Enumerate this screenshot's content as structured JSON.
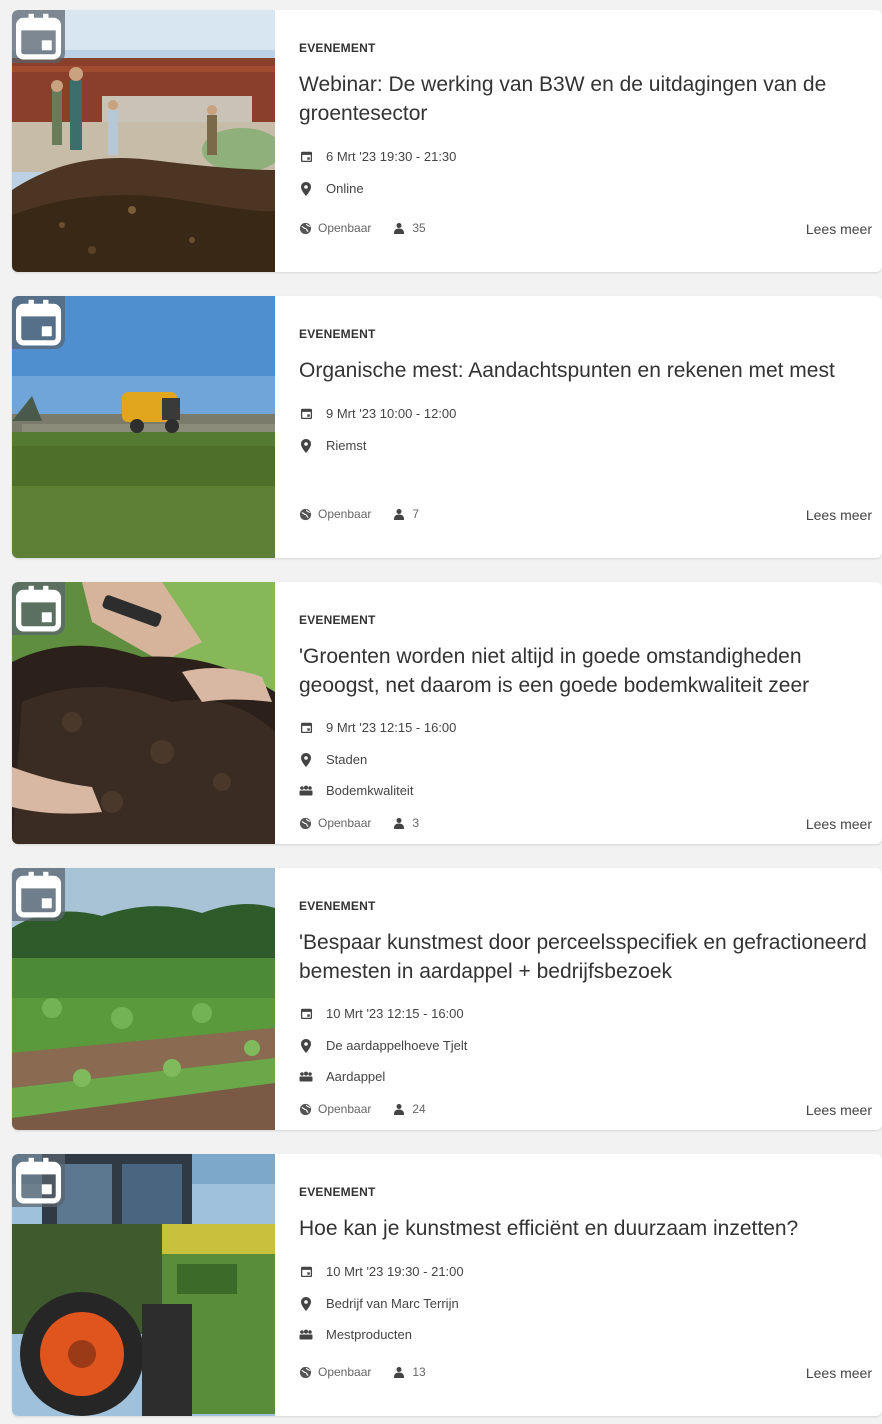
{
  "events": [
    {
      "type": "EVENEMENT",
      "title": "Webinar: De werking van B3W en de uitdagingen van de groentesector",
      "date": "6 Mrt '23 19:30 - 21:30",
      "location": "Online",
      "topic": null,
      "visibility": "Openbaar",
      "attendees": "35",
      "read_more": "Lees meer"
    },
    {
      "type": "EVENEMENT",
      "title": "Organische mest: Aandachtspunten en rekenen met mest",
      "date": "9 Mrt '23 10:00 - 12:00",
      "location": "Riemst",
      "topic": null,
      "visibility": "Openbaar",
      "attendees": "7",
      "read_more": "Lees meer"
    },
    {
      "type": "EVENEMENT",
      "title": "'Groenten worden niet altijd in goede omstandigheden geoogst, net daarom is een goede bodemkwaliteit zeer",
      "date": "9 Mrt '23 12:15 - 16:00",
      "location": "Staden",
      "topic": "Bodemkwaliteit",
      "visibility": "Openbaar",
      "attendees": "3",
      "read_more": "Lees meer"
    },
    {
      "type": "EVENEMENT",
      "title": "'Bespaar kunstmest door perceelsspecifiek en gefractioneerd bemesten in aardappel + bedrijfsbezoek",
      "date": "10 Mrt '23 12:15 - 16:00",
      "location": "De aardappelhoeve Tjelt",
      "topic": "Aardappel",
      "visibility": "Openbaar",
      "attendees": "24",
      "read_more": "Lees meer"
    },
    {
      "type": "EVENEMENT",
      "title": "Hoe kan je kunstmest efficiënt en duurzaam inzetten?",
      "date": "10 Mrt '23 19:30 - 21:00",
      "location": "Bedrijf van Marc Terrijn",
      "topic": "Mestproducten",
      "visibility": "Openbaar",
      "attendees": "13",
      "read_more": "Lees meer"
    }
  ],
  "icons": {
    "calendar": "calendar-icon",
    "location": "map-pin-icon",
    "topic": "group-icon",
    "visibility": "globe-icon",
    "attendees": "person-icon"
  },
  "colors": {
    "badge": "#5a646e",
    "card": "#ffffff",
    "background": "#f2f2f2"
  }
}
